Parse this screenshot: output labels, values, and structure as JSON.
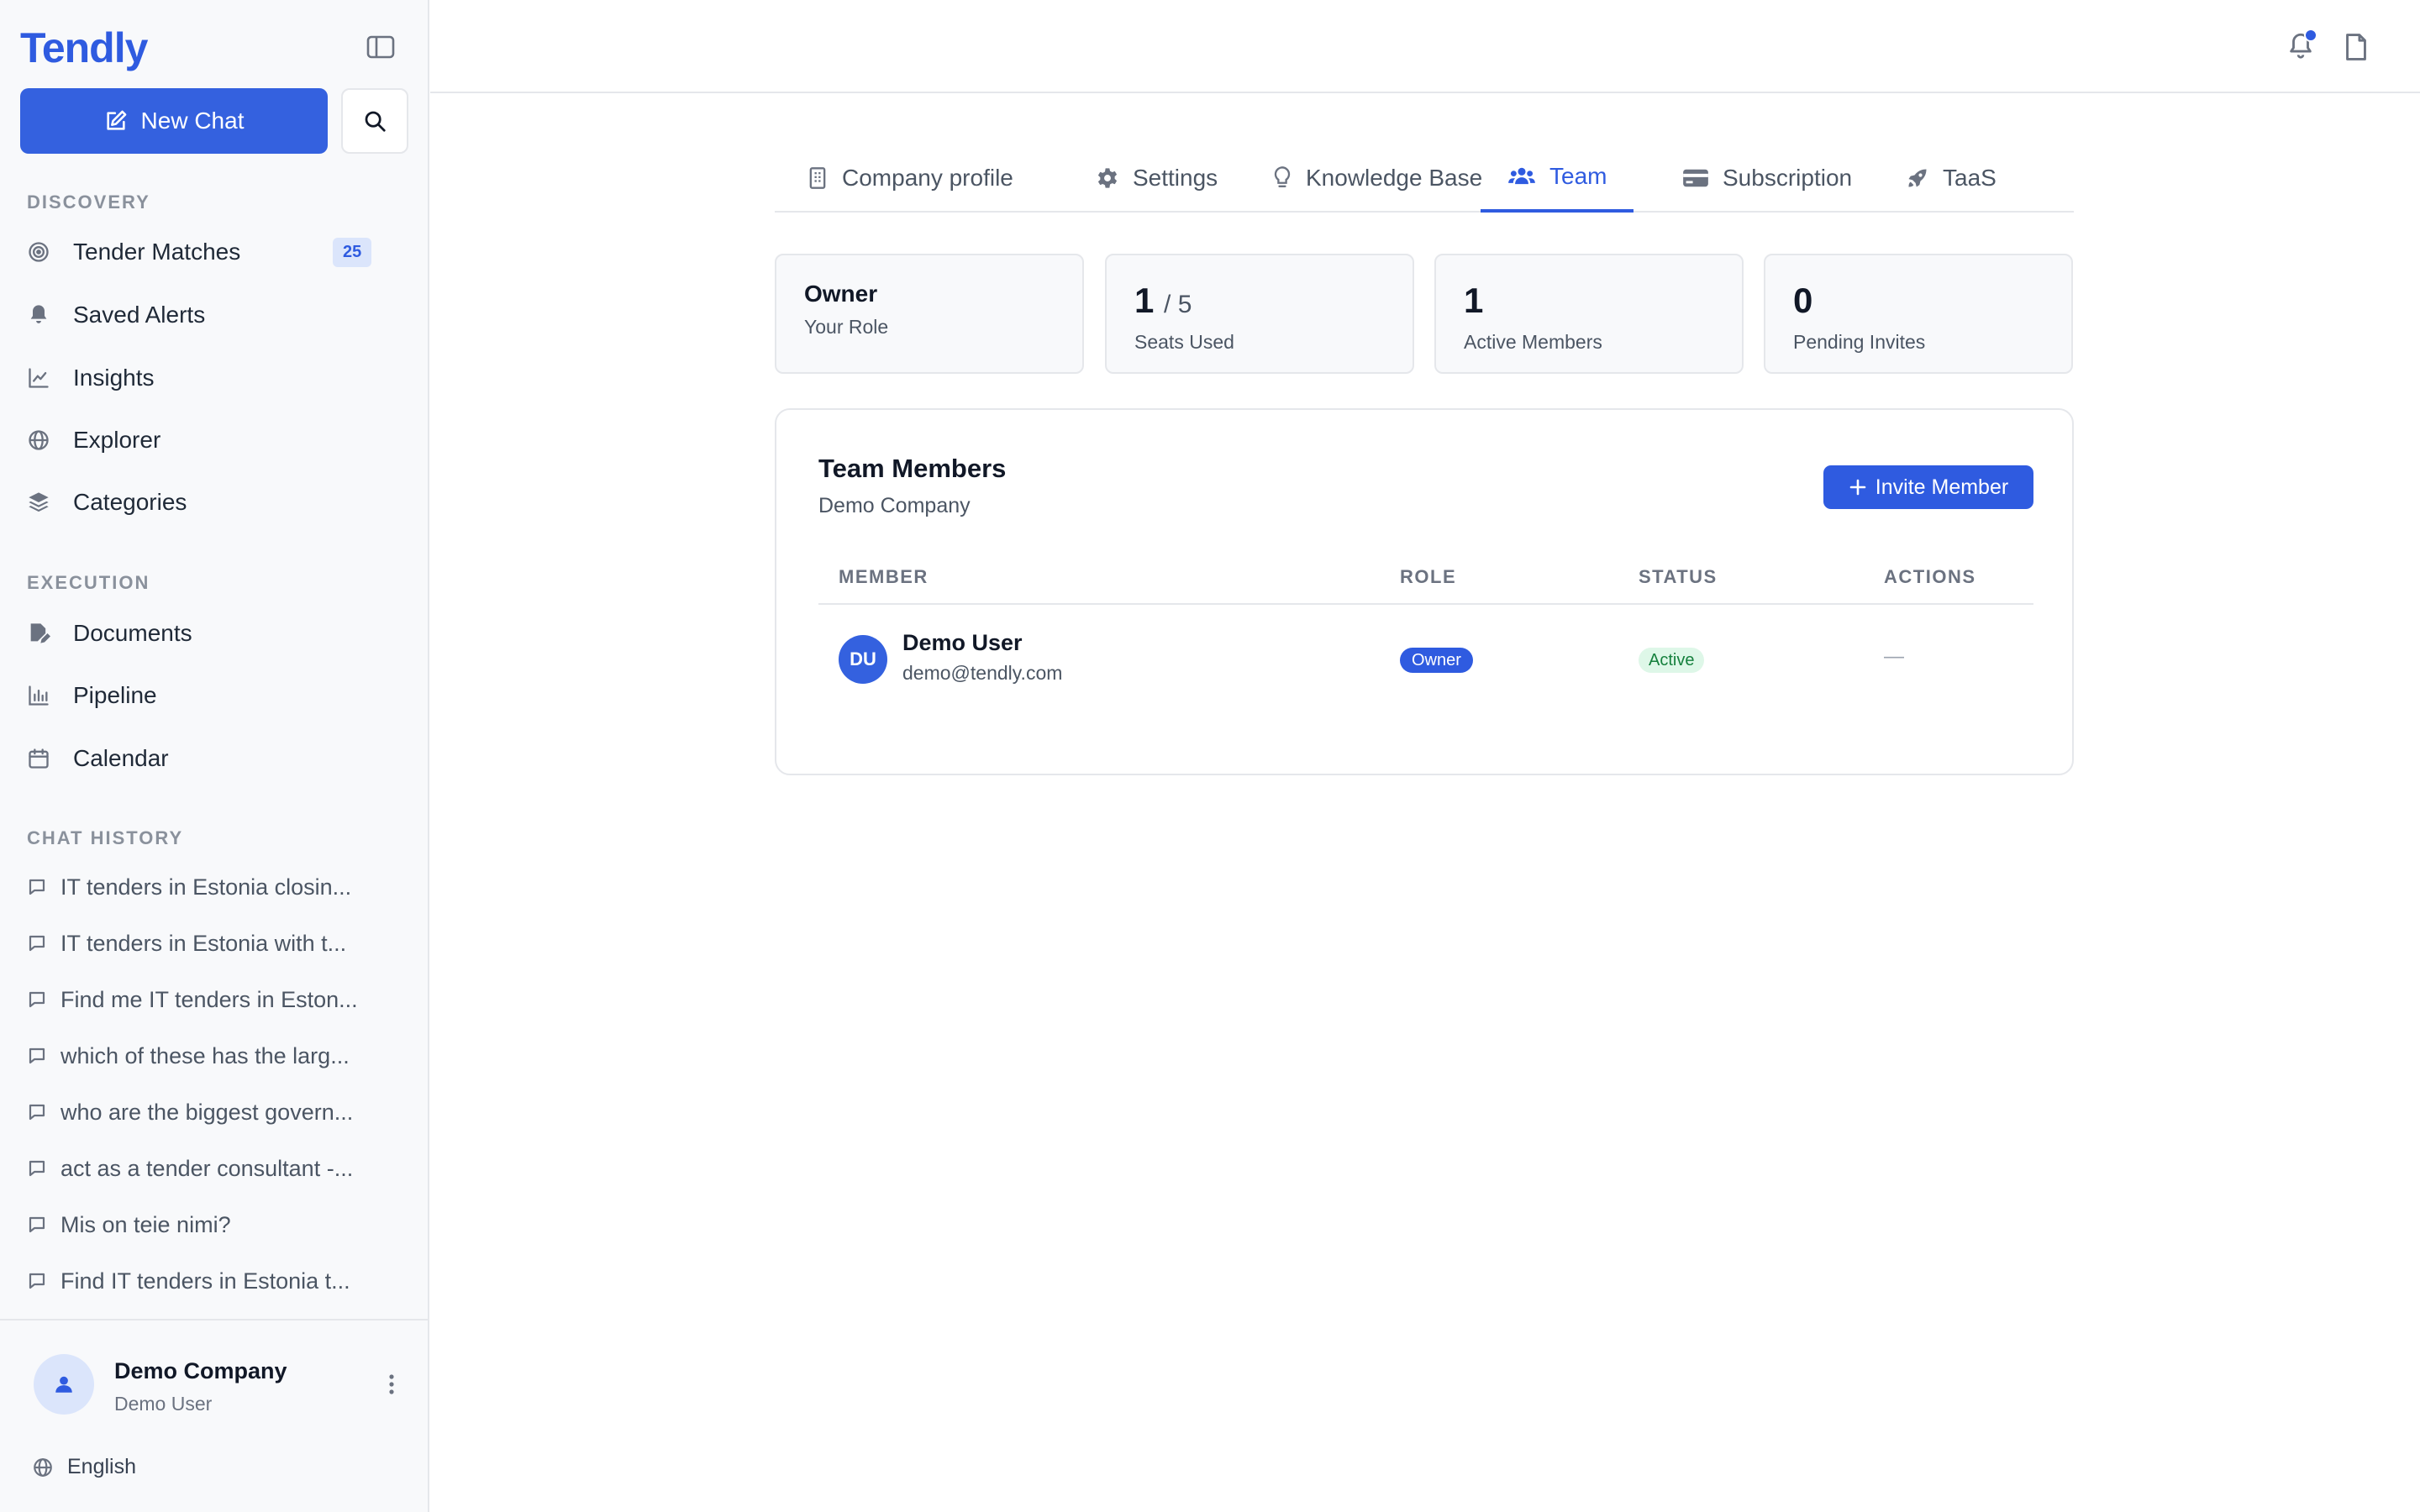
{
  "sidebar": {
    "logo": "Tendly",
    "new_chat_label": "New Chat",
    "sections": {
      "discovery": "DISCOVERY",
      "execution": "EXECUTION",
      "chat_history": "CHAT HISTORY"
    },
    "discovery_items": [
      {
        "label": "Tender Matches",
        "icon": "target-icon",
        "badge": "25"
      },
      {
        "label": "Saved Alerts",
        "icon": "bell-icon"
      },
      {
        "label": "Insights",
        "icon": "line-chart-icon"
      },
      {
        "label": "Explorer",
        "icon": "globe-icon"
      },
      {
        "label": "Categories",
        "icon": "layers-icon"
      }
    ],
    "execution_items": [
      {
        "label": "Documents",
        "icon": "file-edit-icon"
      },
      {
        "label": "Pipeline",
        "icon": "bar-chart-icon"
      },
      {
        "label": "Calendar",
        "icon": "calendar-icon"
      }
    ],
    "chat_history": [
      "IT tenders in Estonia closin...",
      "IT tenders in Estonia with t...",
      "Find me IT tenders in Eston...",
      "which of these has the larg...",
      "who are the biggest govern...",
      "act as a tender consultant -...",
      "Mis on teie nimi?",
      "Find IT tenders in Estonia t..."
    ],
    "footer": {
      "company": "Demo Company",
      "user": "Demo User",
      "language": "English"
    }
  },
  "tabs": [
    {
      "label": "Company profile",
      "icon": "building-icon",
      "active": false
    },
    {
      "label": "Settings",
      "icon": "gear-icon",
      "active": false
    },
    {
      "label": "Knowledge Base",
      "icon": "lightbulb-icon",
      "active": false
    },
    {
      "label": "Team",
      "icon": "users-icon",
      "active": true
    },
    {
      "label": "Subscription",
      "icon": "credit-card-icon",
      "active": false
    },
    {
      "label": "TaaS",
      "icon": "rocket-icon",
      "active": false
    }
  ],
  "stats": {
    "role": {
      "value": "Owner",
      "label": "Your Role"
    },
    "seats": {
      "value": "1",
      "of": "/ 5",
      "label": "Seats Used"
    },
    "active": {
      "value": "1",
      "label": "Active Members"
    },
    "pending": {
      "value": "0",
      "label": "Pending Invites"
    }
  },
  "members": {
    "title": "Team Members",
    "subtitle": "Demo Company",
    "invite_label": "Invite Member",
    "columns": [
      "MEMBER",
      "ROLE",
      "STATUS",
      "ACTIONS"
    ],
    "rows": [
      {
        "initials": "DU",
        "name": "Demo User",
        "email": "demo@tendly.com",
        "role": "Owner",
        "status": "Active",
        "actions": "—"
      }
    ]
  },
  "colors": {
    "accent": "#2f5be0",
    "status_active_bg": "#def7e8",
    "status_active_text": "#15803d"
  }
}
